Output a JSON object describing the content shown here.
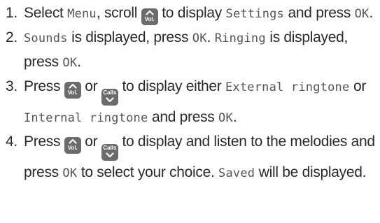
{
  "colors": {
    "text": "#2a2a2a",
    "key_bg": "#6b6b6b",
    "lcd_text": "#555555"
  },
  "keys": {
    "up_label": "Vol.",
    "down_label": "Calls",
    "up_icon": "chevron-up-icon",
    "down_icon": "chevron-down-icon"
  },
  "steps": [
    {
      "number": "1.",
      "t1": "Select",
      "lcd_menu": "Menu",
      "t2": ", scroll",
      "t3": "to display",
      "lcd_settings": "Settings",
      "t4": "and press",
      "lcd_ok": "OK",
      "t5": "."
    },
    {
      "number": "2.",
      "lcd_sounds": "Sounds",
      "t1": "is displayed, press",
      "lcd_ok1": "OK",
      "t2": ".",
      "lcd_ringing": "Ringing",
      "t3": "is displayed, press",
      "lcd_ok2": "OK",
      "t4": "."
    },
    {
      "number": "3.",
      "t1": "Press",
      "t2": "or",
      "t3": "to display either",
      "lcd_external": "External ringtone",
      "t4": "or",
      "lcd_internal": "Internal ringtone",
      "t5": "and press",
      "lcd_ok": "OK",
      "t6": "."
    },
    {
      "number": "4.",
      "t1": "Press",
      "t2": "or",
      "t3": "to display and listen to the melodies and press",
      "lcd_ok": "OK",
      "t4": "to select your choice.",
      "lcd_saved": "Saved",
      "t5": "will be displayed."
    }
  ]
}
